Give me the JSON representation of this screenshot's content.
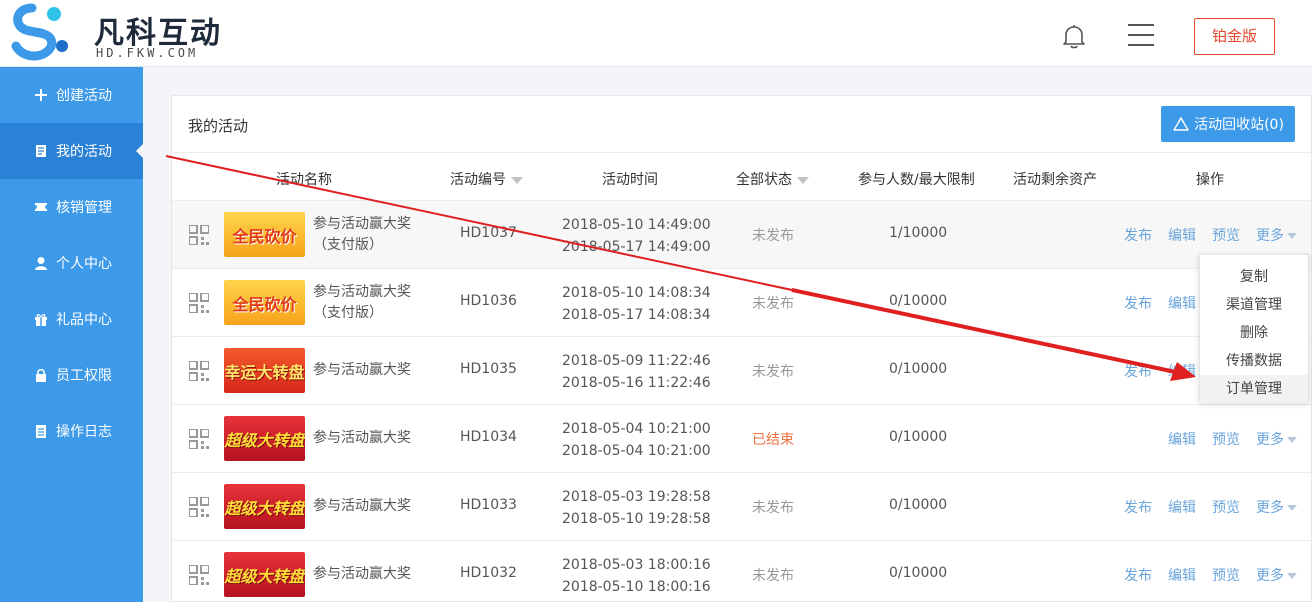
{
  "header": {
    "logo_title": "凡科互动",
    "logo_sub": "HD.FKW.COM",
    "plan_button": "铂金版"
  },
  "sidebar": {
    "items": [
      {
        "label": "创建活动",
        "icon": "plus-icon"
      },
      {
        "label": "我的活动",
        "icon": "document-icon"
      },
      {
        "label": "核销管理",
        "icon": "ticket-icon"
      },
      {
        "label": "个人中心",
        "icon": "user-icon"
      },
      {
        "label": "礼品中心",
        "icon": "gift-icon"
      },
      {
        "label": "员工权限",
        "icon": "lock-icon"
      },
      {
        "label": "操作日志",
        "icon": "log-icon"
      }
    ],
    "active_index": 1
  },
  "panel": {
    "title": "我的活动",
    "recycle_button": "活动回收站(0)"
  },
  "table": {
    "headers": {
      "name": "活动名称",
      "number": "活动编号",
      "time": "活动时间",
      "status": "全部状态",
      "count": "参与人数/最大限制",
      "assets": "活动剩余资产",
      "ops": "操作"
    },
    "rows": [
      {
        "thumb": "全民砍价",
        "thumb_type": "kanjia",
        "name1": "参与活动赢大奖",
        "name2": "（支付版）",
        "number": "HD1037",
        "start": "2018-05-10 14:49:00",
        "end": "2018-05-17 14:49:00",
        "status": "未发布",
        "count": "1/10000"
      },
      {
        "thumb": "全民砍价",
        "thumb_type": "kanjia",
        "name1": "参与活动赢大奖",
        "name2": "（支付版）",
        "number": "HD1036",
        "start": "2018-05-10 14:08:34",
        "end": "2018-05-17 14:08:34",
        "status": "未发布",
        "count": "0/10000"
      },
      {
        "thumb": "幸运大转盘",
        "thumb_type": "xingyun",
        "name1": "参与活动赢大奖",
        "name2": "",
        "number": "HD1035",
        "start": "2018-05-09 11:22:46",
        "end": "2018-05-16 11:22:46",
        "status": "未发布",
        "count": "0/10000"
      },
      {
        "thumb": "超级大转盘",
        "thumb_type": "zhuanpan",
        "name1": "参与活动赢大奖",
        "name2": "",
        "number": "HD1034",
        "start": "2018-05-04 10:21:00",
        "end": "2018-05-04 10:21:00",
        "status": "已结束",
        "count": "0/10000"
      },
      {
        "thumb": "超级大转盘",
        "thumb_type": "zhuanpan",
        "name1": "参与活动赢大奖",
        "name2": "",
        "number": "HD1033",
        "start": "2018-05-03 19:28:58",
        "end": "2018-05-10 19:28:58",
        "status": "未发布",
        "count": "0/10000"
      },
      {
        "thumb": "超级大转盘",
        "thumb_type": "zhuanpan",
        "name1": "参与活动赢大奖",
        "name2": "",
        "number": "HD1032",
        "start": "2018-05-03 18:00:16",
        "end": "2018-05-10 18:00:16",
        "status": "未发布",
        "count": "0/10000"
      }
    ],
    "ops": {
      "publish": "发布",
      "edit": "编辑",
      "preview": "预览",
      "more": "更多"
    }
  },
  "dropdown": {
    "items": [
      "复制",
      "渠道管理",
      "删除",
      "传播数据",
      "订单管理"
    ],
    "highlighted_index": 4
  },
  "colors": {
    "sidebar": "#3c9ae9",
    "accent": "#e44a2e",
    "link": "#6aa4dc",
    "annotation_arrow": "#e02020"
  }
}
